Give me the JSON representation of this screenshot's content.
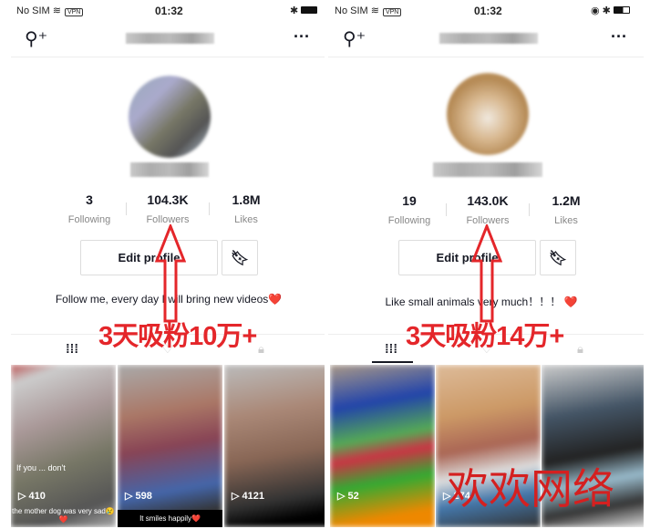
{
  "profiles": [
    {
      "status": {
        "carrier": "No SIM",
        "vpn": "VPN",
        "time": "01:32"
      },
      "stats": [
        {
          "value": "3",
          "label": "Following"
        },
        {
          "value": "104.3K",
          "label": "Followers"
        },
        {
          "value": "1.8M",
          "label": "Likes"
        }
      ],
      "edit_label": "Edit profile",
      "bio": "Follow me, every day I will bring new videos❤️",
      "promo": "3天吸粉10万+",
      "videos": [
        {
          "views": "410",
          "caption": "the mother dog was very sad😢❤️",
          "overlay": "If you ... don't"
        },
        {
          "views": "598",
          "caption": "It smiles happily❤️"
        },
        {
          "views": "4121",
          "caption": ""
        }
      ]
    },
    {
      "status": {
        "carrier": "No SIM",
        "vpn": "VPN",
        "time": "01:32"
      },
      "stats": [
        {
          "value": "19",
          "label": "Following"
        },
        {
          "value": "143.0K",
          "label": "Followers"
        },
        {
          "value": "1.2M",
          "label": "Likes"
        }
      ],
      "edit_label": "Edit profile",
      "bio": "Like small animals very much！！！ ❤️",
      "promo": "3天吸粉14万+",
      "videos": [
        {
          "views": "52"
        },
        {
          "views": "274"
        },
        {
          "views": ""
        }
      ]
    }
  ],
  "watermark": "欢欢网络",
  "colors": {
    "promo": "#e4262a",
    "accent": "#fe2c55"
  }
}
